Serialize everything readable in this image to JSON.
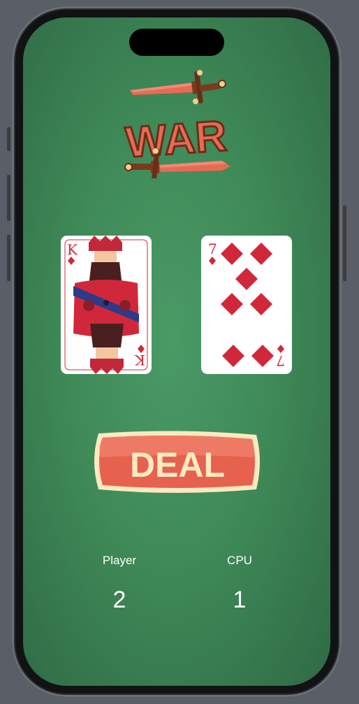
{
  "title": "WAR",
  "player_card": {
    "rank": "K",
    "suit": "diamonds"
  },
  "cpu_card": {
    "rank": "7",
    "suit": "diamonds"
  },
  "deal_button": {
    "label": "DEAL"
  },
  "scores": {
    "player_label": "Player",
    "cpu_label": "CPU",
    "player_score": "2",
    "cpu_score": "1"
  },
  "colors": {
    "table_green": "#3f8a58",
    "accent_red": "#e05a4a",
    "cream": "#fbeac0",
    "suit_red": "#d0283a"
  }
}
